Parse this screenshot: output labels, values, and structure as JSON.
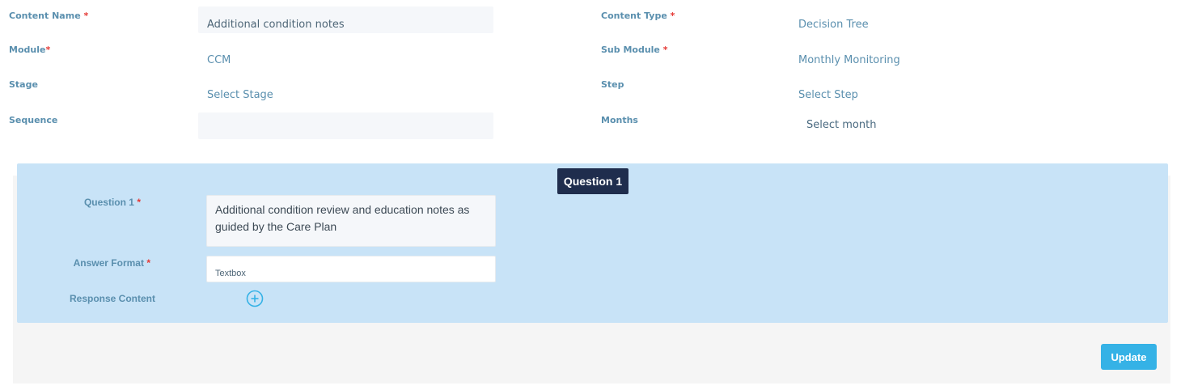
{
  "form": {
    "content_name": {
      "label": "Content Name",
      "required_mark": "*",
      "value": "Additional condition notes"
    },
    "content_type": {
      "label": "Content Type",
      "required_mark": "*",
      "value": "Decision Tree"
    },
    "module": {
      "label": "Module",
      "required_mark": "*",
      "value": "CCM"
    },
    "sub_module": {
      "label": "Sub Module",
      "required_mark": "*",
      "value": "Monthly Monitoring"
    },
    "stage": {
      "label": "Stage",
      "value": "Select Stage"
    },
    "step": {
      "label": "Step",
      "value": "Select Step"
    },
    "sequence": {
      "label": "Sequence",
      "value": ""
    },
    "months": {
      "label": "Months",
      "value": "Select month"
    }
  },
  "question": {
    "badge": "Question 1",
    "question_label": "Question 1",
    "required_mark": "*",
    "question_text": "Additional condition review and education notes as guided by the Care Plan",
    "answer_format_label": "Answer Format",
    "answer_format_value": "Textbox",
    "response_content_label": "Response Content",
    "add_icon": "plus-circle-icon"
  },
  "actions": {
    "update_label": "Update"
  },
  "colors": {
    "label": "#5a8fae",
    "required": "#e53935",
    "panel": "#c8e3f7",
    "badge": "#1f2d4d",
    "button": "#35b2e6"
  }
}
